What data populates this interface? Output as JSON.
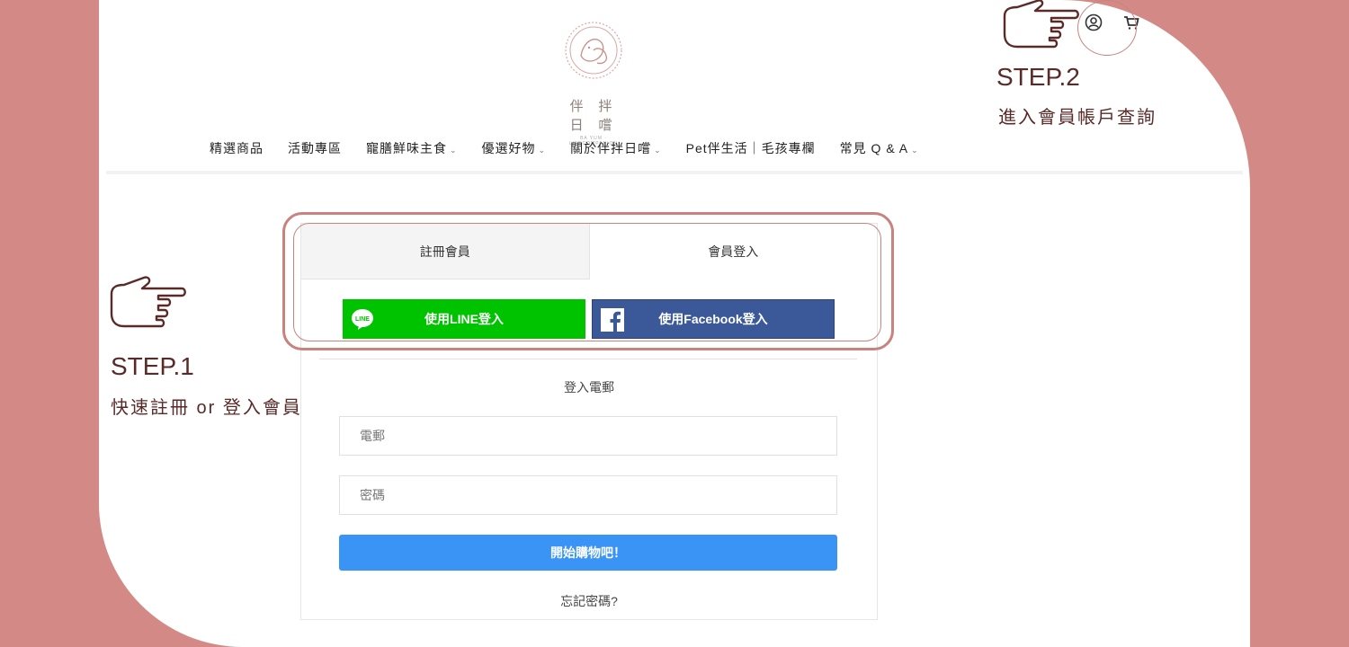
{
  "logo": {
    "name": "伴 拌 日 嚐",
    "tagline": "BA YUM · LIFECOMPANION"
  },
  "header_icons": [
    "user-circle-icon",
    "cart-icon",
    "menu-list-icon"
  ],
  "nav": {
    "items": [
      {
        "label": "精選商品"
      },
      {
        "label": "活動專區"
      },
      {
        "label": "寵膳鮮味主食"
      },
      {
        "label": "優選好物"
      },
      {
        "label": "關於伴拌日嚐"
      },
      {
        "label": "Pet伴生活｜毛孩專欄"
      },
      {
        "label": "常見 Q & A"
      }
    ]
  },
  "tabs": {
    "register": "註冊會員",
    "login": "會員登入"
  },
  "social": {
    "line_label": "使用LINE登入",
    "line_badge": "LINE",
    "facebook_label": "使用Facebook登入"
  },
  "login": {
    "title": "登入電郵",
    "email_placeholder": "電郵",
    "password_placeholder": "密碼",
    "submit_label": "開始購物吧！",
    "forgot_label": "忘記密碼?"
  },
  "steps": {
    "step1": {
      "title": "STEP.1",
      "desc": "快速註冊 or 登入會員"
    },
    "step2": {
      "title": "STEP.2",
      "desc": "進入會員帳戶查詢"
    }
  },
  "colors": {
    "background": "#d38a86",
    "highlight": "#c8837f",
    "step_text": "#5a2a28",
    "line_green": "#00c300",
    "facebook_blue": "#3b5998",
    "submit_blue": "#3a94f5"
  }
}
